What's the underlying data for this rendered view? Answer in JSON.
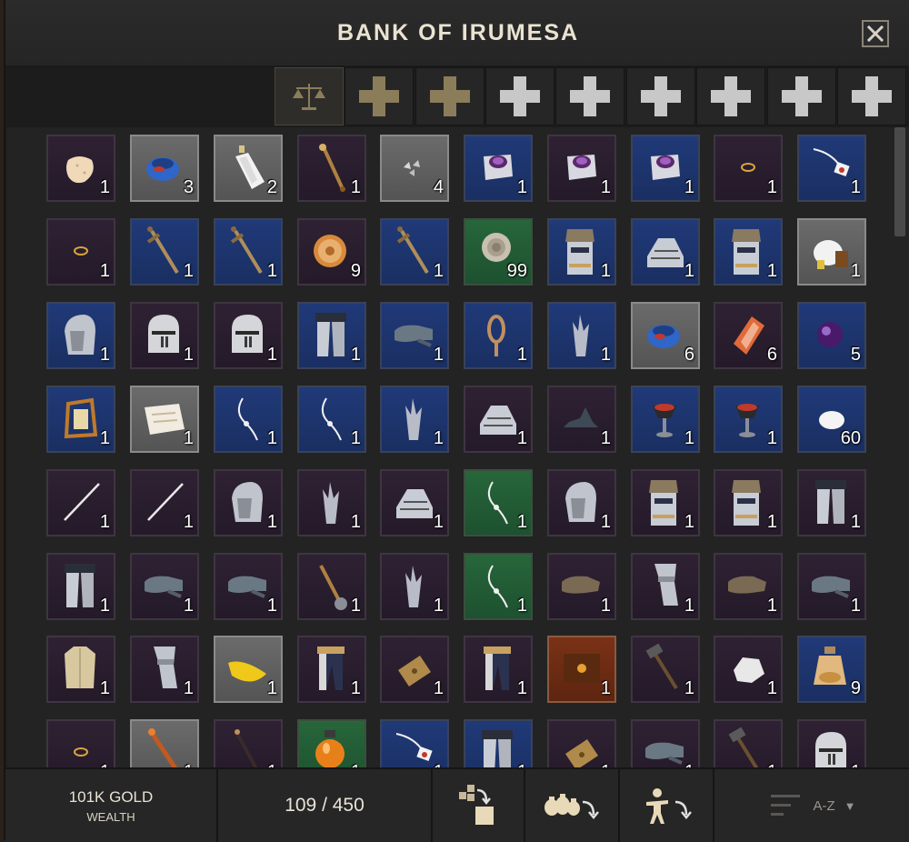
{
  "window": {
    "title": "BANK OF IRUMESA"
  },
  "tabs": [
    {
      "icon": "scales-icon",
      "active": true
    },
    {
      "icon": "plus-icon",
      "color": "#8b7d5a"
    },
    {
      "icon": "plus-icon",
      "color": "#8b7d5a"
    },
    {
      "icon": "plus-icon",
      "color": "#c8c8c8"
    },
    {
      "icon": "plus-icon",
      "color": "#c8c8c8"
    },
    {
      "icon": "plus-icon",
      "color": "#c8c8c8"
    },
    {
      "icon": "plus-icon",
      "color": "#c8c8c8"
    },
    {
      "icon": "plus-icon",
      "color": "#c8c8c8"
    },
    {
      "icon": "plus-icon",
      "color": "#c8c8c8"
    }
  ],
  "colors": {
    "purple": "#2e2133",
    "blue": "#203a78",
    "green": "#27663a",
    "gray": "#6b6b6b",
    "brown": "#7a3216",
    "text": "#e8e2d6"
  },
  "items": [
    [
      {
        "rarity": "purple",
        "icon": "cookie-icon",
        "qty": "1"
      },
      {
        "rarity": "gray",
        "icon": "blue-pouch-icon",
        "qty": "3"
      },
      {
        "rarity": "gray",
        "icon": "bottle-icon",
        "qty": "2"
      },
      {
        "rarity": "purple",
        "icon": "wand-icon",
        "qty": "1"
      },
      {
        "rarity": "gray",
        "icon": "shards-icon",
        "qty": "4"
      },
      {
        "rarity": "blue",
        "icon": "ring-icon",
        "qty": "1"
      },
      {
        "rarity": "purple",
        "icon": "ring-icon",
        "qty": "1"
      },
      {
        "rarity": "blue",
        "icon": "ring-icon",
        "qty": "1"
      },
      {
        "rarity": "purple",
        "icon": "small-ring-icon",
        "qty": "1"
      },
      {
        "rarity": "blue",
        "icon": "amulet-icon",
        "qty": "1"
      }
    ],
    [
      {
        "rarity": "purple",
        "icon": "small-ring-icon",
        "qty": "1"
      },
      {
        "rarity": "blue",
        "icon": "sword-icon",
        "qty": "1"
      },
      {
        "rarity": "blue",
        "icon": "sword-icon",
        "qty": "1"
      },
      {
        "rarity": "purple",
        "icon": "shield-icon",
        "qty": "9"
      },
      {
        "rarity": "blue",
        "icon": "sword-icon",
        "qty": "1"
      },
      {
        "rarity": "green",
        "icon": "rope-icon",
        "qty": "99"
      },
      {
        "rarity": "blue",
        "icon": "gauntlet-icon",
        "qty": "1"
      },
      {
        "rarity": "blue",
        "icon": "boots-icon",
        "qty": "1"
      },
      {
        "rarity": "blue",
        "icon": "gauntlet-icon",
        "qty": "1"
      },
      {
        "rarity": "gray",
        "icon": "bag-icon",
        "qty": "1"
      }
    ],
    [
      {
        "rarity": "blue",
        "icon": "helmet-icon",
        "qty": "1"
      },
      {
        "rarity": "purple",
        "icon": "knight-helm-icon",
        "qty": "1"
      },
      {
        "rarity": "purple",
        "icon": "knight-helm-icon",
        "qty": "1"
      },
      {
        "rarity": "blue",
        "icon": "legs-icon",
        "qty": "1"
      },
      {
        "rarity": "blue",
        "icon": "glove-icon",
        "qty": "1"
      },
      {
        "rarity": "blue",
        "icon": "rope-coil-icon",
        "qty": "1"
      },
      {
        "rarity": "blue",
        "icon": "claw-icon",
        "qty": "1"
      },
      {
        "rarity": "gray",
        "icon": "blue-pouch-icon",
        "qty": "6"
      },
      {
        "rarity": "purple",
        "icon": "crystal-icon",
        "qty": "6"
      },
      {
        "rarity": "blue",
        "icon": "orb-icon",
        "qty": "5"
      }
    ],
    [
      {
        "rarity": "blue",
        "icon": "lantern-icon",
        "qty": "1"
      },
      {
        "rarity": "gray",
        "icon": "map-icon",
        "qty": "1"
      },
      {
        "rarity": "blue",
        "icon": "necklace-icon",
        "qty": "1"
      },
      {
        "rarity": "blue",
        "icon": "necklace-icon",
        "qty": "1"
      },
      {
        "rarity": "blue",
        "icon": "claw-icon",
        "qty": "1"
      },
      {
        "rarity": "purple",
        "icon": "boots-icon",
        "qty": "1"
      },
      {
        "rarity": "purple",
        "icon": "hat-icon",
        "qty": "1"
      },
      {
        "rarity": "blue",
        "icon": "goblet-icon",
        "qty": "1"
      },
      {
        "rarity": "blue",
        "icon": "goblet-icon",
        "qty": "1"
      },
      {
        "rarity": "blue",
        "icon": "egg-icon",
        "qty": "60"
      }
    ],
    [
      {
        "rarity": "purple",
        "icon": "needle-icon",
        "qty": "1"
      },
      {
        "rarity": "purple",
        "icon": "needle-icon",
        "qty": "1"
      },
      {
        "rarity": "purple",
        "icon": "helmet-icon",
        "qty": "1"
      },
      {
        "rarity": "purple",
        "icon": "claw-icon",
        "qty": "1"
      },
      {
        "rarity": "purple",
        "icon": "boots-icon",
        "qty": "1"
      },
      {
        "rarity": "green",
        "icon": "necklace-icon",
        "qty": "1"
      },
      {
        "rarity": "purple",
        "icon": "helmet-icon",
        "qty": "1"
      },
      {
        "rarity": "purple",
        "icon": "gauntlet-icon",
        "qty": "1"
      },
      {
        "rarity": "purple",
        "icon": "gauntlet-icon",
        "qty": "1"
      },
      {
        "rarity": "purple",
        "icon": "legs-icon",
        "qty": "1"
      }
    ],
    [
      {
        "rarity": "purple",
        "icon": "legs-icon",
        "qty": "1"
      },
      {
        "rarity": "purple",
        "icon": "glove-icon",
        "qty": "1"
      },
      {
        "rarity": "purple",
        "icon": "glove-icon",
        "qty": "1"
      },
      {
        "rarity": "purple",
        "icon": "mace-icon",
        "qty": "1"
      },
      {
        "rarity": "purple",
        "icon": "claw-icon",
        "qty": "1"
      },
      {
        "rarity": "green",
        "icon": "necklace-icon",
        "qty": "1"
      },
      {
        "rarity": "purple",
        "icon": "leather-glove-icon",
        "qty": "1"
      },
      {
        "rarity": "purple",
        "icon": "greave-icon",
        "qty": "1"
      },
      {
        "rarity": "purple",
        "icon": "leather-glove-icon",
        "qty": "1"
      },
      {
        "rarity": "purple",
        "icon": "glove-icon",
        "qty": "1"
      }
    ],
    [
      {
        "rarity": "purple",
        "icon": "vest-icon",
        "qty": "1"
      },
      {
        "rarity": "purple",
        "icon": "greave-icon",
        "qty": "1"
      },
      {
        "rarity": "gray",
        "icon": "banana-icon",
        "qty": "1"
      },
      {
        "rarity": "purple",
        "icon": "pants-icon",
        "qty": "1"
      },
      {
        "rarity": "purple",
        "icon": "book-icon",
        "qty": "1"
      },
      {
        "rarity": "purple",
        "icon": "pants-icon",
        "qty": "1"
      },
      {
        "rarity": "brown",
        "icon": "spellbook-icon",
        "qty": "1"
      },
      {
        "rarity": "purple",
        "icon": "hammer-icon",
        "qty": "1"
      },
      {
        "rarity": "purple",
        "icon": "stone-icon",
        "qty": "1"
      },
      {
        "rarity": "blue",
        "icon": "potion-icon",
        "qty": "9"
      }
    ],
    [
      {
        "rarity": "purple",
        "icon": "small-ring-icon",
        "qty": "1"
      },
      {
        "rarity": "gray",
        "icon": "fire-staff-icon",
        "qty": "1"
      },
      {
        "rarity": "purple",
        "icon": "dark-staff-icon",
        "qty": "1"
      },
      {
        "rarity": "green",
        "icon": "orange-potion-icon",
        "qty": "1"
      },
      {
        "rarity": "blue",
        "icon": "amulet-icon",
        "qty": "1"
      },
      {
        "rarity": "blue",
        "icon": "legs-icon",
        "qty": "1"
      },
      {
        "rarity": "purple",
        "icon": "book-icon",
        "qty": "1"
      },
      {
        "rarity": "purple",
        "icon": "glove-icon",
        "qty": "1"
      },
      {
        "rarity": "purple",
        "icon": "hammer-icon",
        "qty": "1"
      },
      {
        "rarity": "purple",
        "icon": "knight-helm-icon",
        "qty": "1"
      }
    ]
  ],
  "footer": {
    "gold_amount": "101K GOLD",
    "gold_label": "WEALTH",
    "capacity": "109 / 450",
    "sort_label": "A-Z",
    "sort_chevron": "▼"
  }
}
